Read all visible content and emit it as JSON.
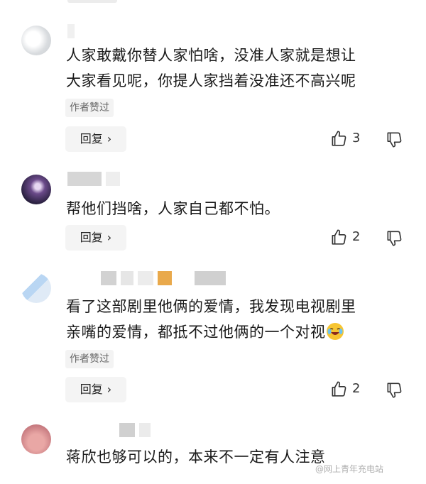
{
  "comments": [
    {
      "lines": [
        "人家敢戴你替人家怕啥，没准人家就是想让",
        "大家看见呢，你提人家挡着没准还不高兴呢"
      ],
      "badge": "作者赞过",
      "reply_label": "回复",
      "likes": "3"
    },
    {
      "lines": [
        "帮他们挡啥，人家自己都不怕。"
      ],
      "reply_label": "回复",
      "likes": "2"
    },
    {
      "lines": [
        "看了这部剧里他俩的爱情，我发现电视剧里",
        "亲嘴的爱情，都抵不过他俩的一个对视"
      ],
      "badge": "作者赞过",
      "reply_label": "回复",
      "likes": "2"
    },
    {
      "lines": [
        "蒋欣也够可以的，本来不一定有人注意"
      ]
    }
  ],
  "watermark": "@网上青年充电站",
  "icons": {
    "like": "thumb-up-icon",
    "dislike": "thumb-down-icon",
    "chevron": "chevron-right-icon",
    "emoji": "laughing-crying-emoji"
  },
  "colors": {
    "reply_bg": "#f4f4f4",
    "badge_bg": "#f3f3f3",
    "text": "#1a1a1a"
  }
}
